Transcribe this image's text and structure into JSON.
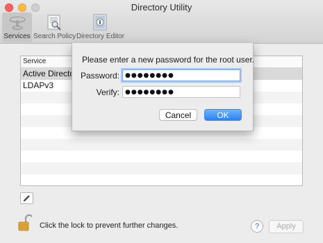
{
  "window": {
    "title": "Directory Utility"
  },
  "toolbar": {
    "items": [
      {
        "label": "Services",
        "icon": "services-icon",
        "selected": true
      },
      {
        "label": "Search Policy",
        "icon": "search-policy-icon"
      },
      {
        "label": "Directory Editor",
        "icon": "directory-editor-icon"
      }
    ]
  },
  "table": {
    "header": "Service",
    "rows": [
      "Active Directory",
      "LDAPv3"
    ]
  },
  "footer": {
    "lock_text": "Click the lock to prevent further changes.",
    "help_label": "?",
    "apply_label": "Apply"
  },
  "dialog": {
    "message": "Please enter a new password for the root user.",
    "password_label": "Password:",
    "password_value": "●●●●●●●●",
    "verify_label": "Verify:",
    "verify_value": "●●●●●●●●",
    "cancel_label": "Cancel",
    "ok_label": "OK"
  },
  "colors": {
    "accent": "#2e82f0",
    "focus_ring": "#a8c8f5",
    "close": "#fc605c",
    "minimize": "#fdbc40"
  }
}
